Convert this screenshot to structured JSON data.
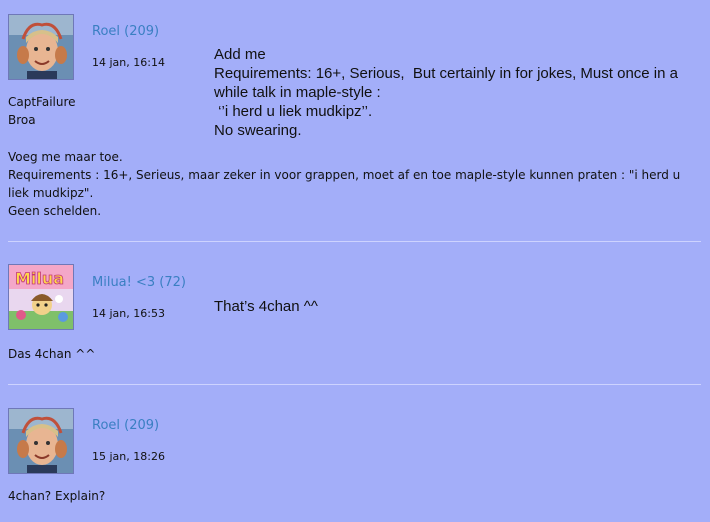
{
  "posts": [
    {
      "username": "Roel (209)",
      "timestamp": "14 jan, 16:14",
      "translation": [
        "Add me",
        "Requirements: 16+, Serious,  But certainly in for jokes, Must once in a",
        "while talk in maple-style :",
        " ‘’i herd u liek mudkipz’’.",
        "No swearing."
      ],
      "signature": [
        "CaptFailure",
        "Broa"
      ],
      "body": [
        "Voeg me maar toe.",
        "Requirements : 16+, Serieus, maar zeker in voor grappen, moet af en toe maple-style kunnen praten : \"i herd u liek mudkipz\".",
        "Geen schelden."
      ],
      "avatar_icon": "boy-photo-avatar"
    },
    {
      "username": "Milua! <3 (72)",
      "timestamp": "14 jan, 16:53",
      "translation": [
        "That’s 4chan ^^"
      ],
      "body": [
        "Das 4chan ^^"
      ],
      "avatar_icon": "milua-cartoon-avatar"
    },
    {
      "username": "Roel (209)",
      "timestamp": "15 jan, 18:26",
      "body": [
        "4chan? Explain?"
      ],
      "avatar_icon": "boy-photo-avatar"
    }
  ],
  "colors": {
    "background": "#a3aef9",
    "username": "#3a7fc2",
    "divider": "#cdd3ff"
  }
}
